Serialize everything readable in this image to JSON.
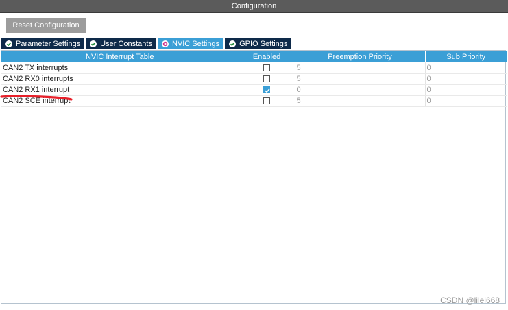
{
  "window": {
    "title": "Configuration"
  },
  "toolbar": {
    "reset_label": "Reset Configuration"
  },
  "tabs": [
    {
      "label": "Parameter Settings",
      "status": "ok"
    },
    {
      "label": "User Constants",
      "status": "ok"
    },
    {
      "label": "NVIC Settings",
      "status": "error",
      "active": true
    },
    {
      "label": "GPIO Settings",
      "status": "ok"
    }
  ],
  "table": {
    "headers": [
      "NVIC Interrupt Table",
      "Enabled",
      "Preemption Priority",
      "Sub Priority"
    ],
    "rows": [
      {
        "name": "CAN2 TX interrupts",
        "enabled": false,
        "preemption": "5",
        "sub": "0"
      },
      {
        "name": "CAN2 RX0 interrupts",
        "enabled": false,
        "preemption": "5",
        "sub": "0"
      },
      {
        "name": "CAN2 RX1 interrupt",
        "enabled": true,
        "preemption": "0",
        "sub": "0"
      },
      {
        "name": "CAN2 SCE interrupt",
        "enabled": false,
        "preemption": "5",
        "sub": "0"
      }
    ]
  },
  "colors": {
    "accent": "#3b9fd6",
    "tab_dark": "#0e2a4a",
    "annotation": "#e8202a"
  },
  "watermark": "CSDN @lilei668"
}
